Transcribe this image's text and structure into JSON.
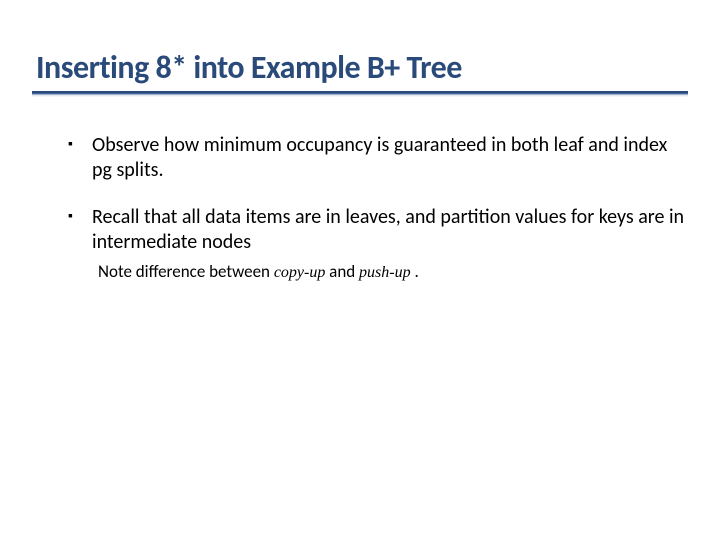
{
  "slide": {
    "title": "Inserting 8* into Example B+ Tree",
    "bullets": [
      {
        "text": "Observe how minimum occupancy is guaranteed in both leaf and index pg splits."
      },
      {
        "text": "Recall that all data items are in leaves, and partition values for keys are in intermediate nodes",
        "note_prefix": "Note difference between ",
        "term1": "copy-up",
        "note_mid": "  and ",
        "term2": "push-up",
        "note_suffix": " ."
      }
    ]
  }
}
